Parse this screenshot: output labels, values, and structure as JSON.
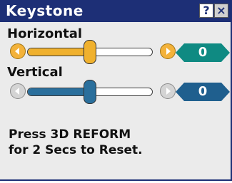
{
  "window": {
    "title": "Keystone",
    "help_label": "?",
    "close_label": "×"
  },
  "horizontal": {
    "label": "Horizontal",
    "value": "0",
    "level": 0.5,
    "fill_color": "#f0b12e",
    "value_box_color": "#0f8a82",
    "arrows": "active"
  },
  "vertical": {
    "label": "Vertical",
    "value": "0",
    "level": 0.5,
    "fill_color": "#2a6f9c",
    "value_box_color": "#1f5f8e",
    "arrows": "inactive"
  },
  "reset_text": "Press 3D REFORM\nfor 2 Secs to Reset."
}
